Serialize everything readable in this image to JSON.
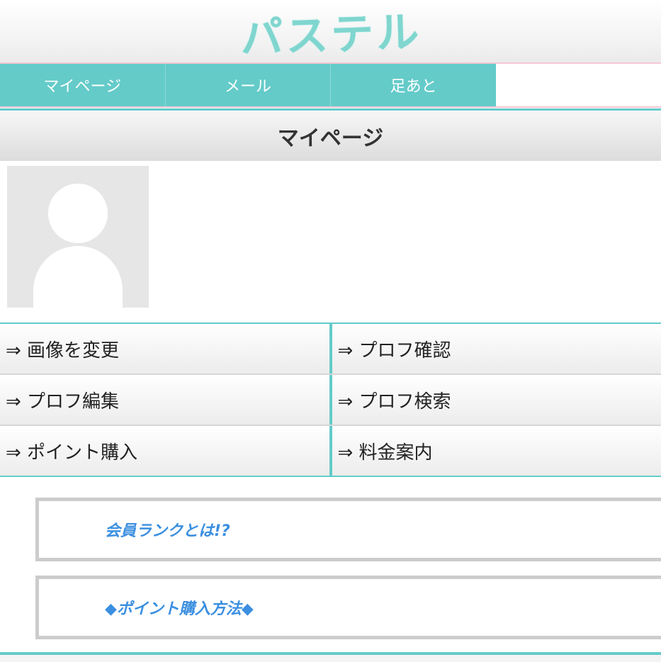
{
  "header": {
    "logo_text": "パステル"
  },
  "tabs": [
    {
      "label": "マイページ"
    },
    {
      "label": "メール"
    },
    {
      "label": "足あと"
    }
  ],
  "page_title": "マイページ",
  "menu": {
    "rows": [
      {
        "left": "⇒ 画像を変更",
        "right": "⇒ プロフ確認"
      },
      {
        "left": "⇒ プロフ編集",
        "right": "⇒ プロフ検索"
      },
      {
        "left": "⇒ ポイント購入",
        "right": "⇒ 料金案内"
      }
    ]
  },
  "banners": [
    {
      "label": "会員ランクとは!?"
    },
    {
      "label": "◆ポイント購入方法◆"
    }
  ],
  "colors": {
    "accent": "#64cbc9",
    "link_blue": "#3b8fe0",
    "logo": "#7fd6cf",
    "pink_line": "#f5c6d3"
  },
  "icons": {
    "avatar": "default-user-silhouette-icon"
  }
}
